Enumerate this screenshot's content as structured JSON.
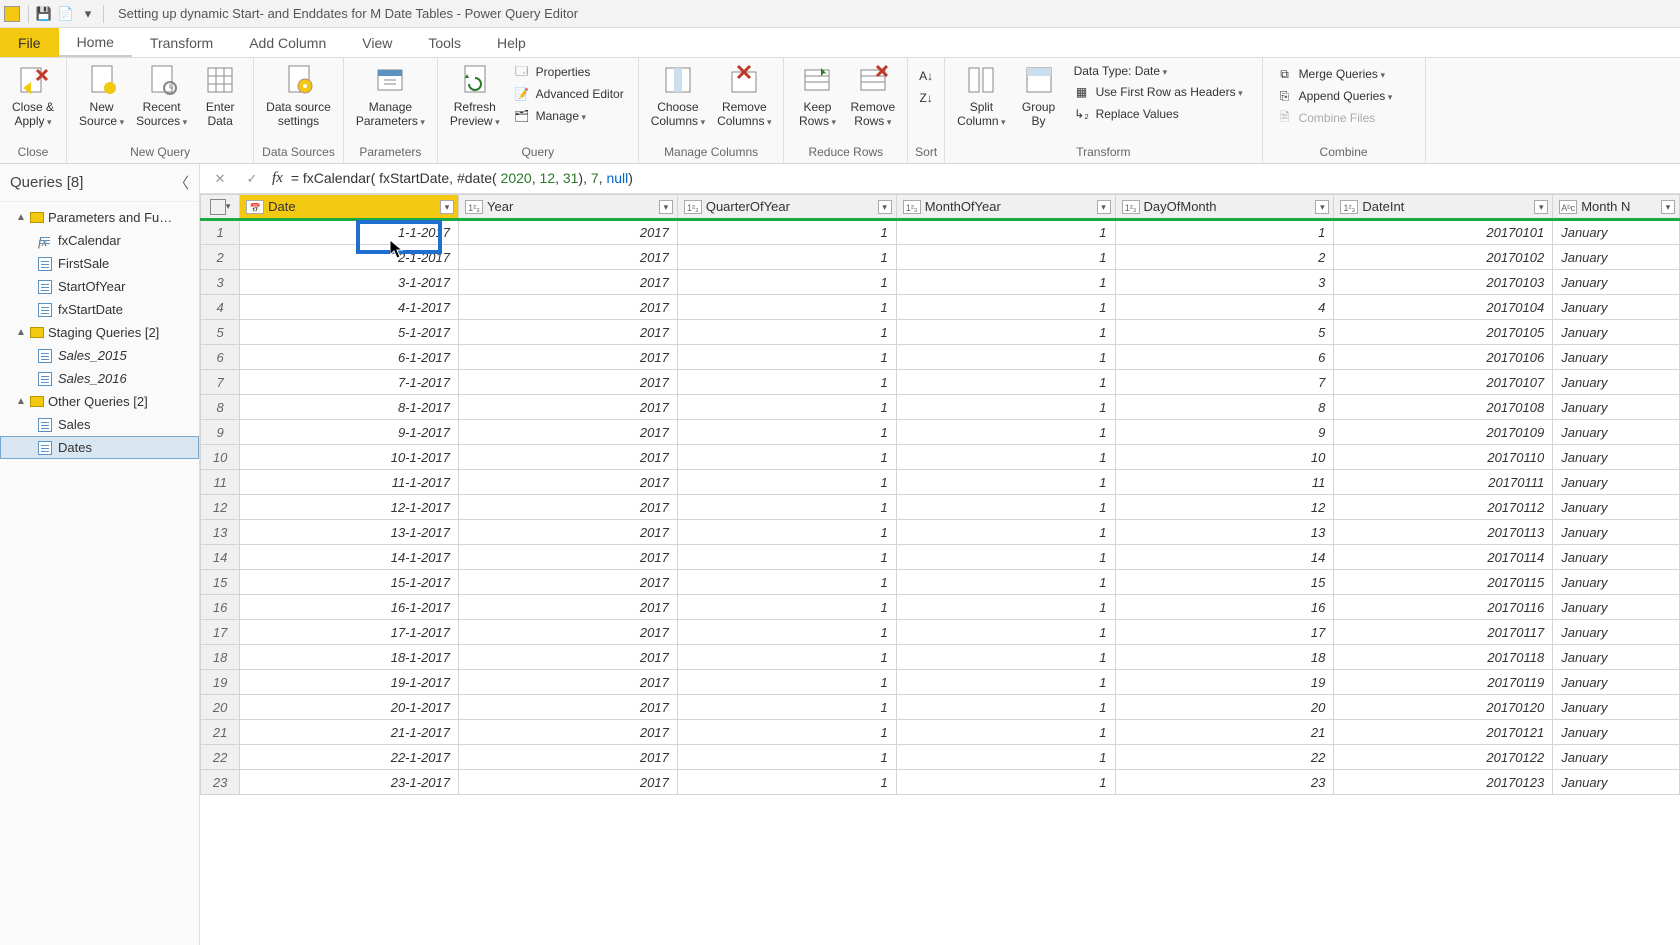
{
  "titlebar": {
    "title": "Setting up dynamic Start- and Enddates for M Date Tables - Power Query Editor"
  },
  "menu": {
    "file": "File",
    "home": "Home",
    "transform": "Transform",
    "addcol": "Add Column",
    "view": "View",
    "tools": "Tools",
    "help": "Help"
  },
  "ribbon": {
    "close": {
      "closeApply": "Close &\nApply",
      "group": "Close"
    },
    "newquery": {
      "newSource": "New\nSource",
      "recentSources": "Recent\nSources",
      "enterData": "Enter\nData",
      "group": "New Query"
    },
    "datasources": {
      "dss": "Data source\nsettings",
      "group": "Data Sources"
    },
    "params": {
      "manageParams": "Manage\nParameters",
      "group": "Parameters"
    },
    "query": {
      "refresh": "Refresh\nPreview",
      "properties": "Properties",
      "advanced": "Advanced Editor",
      "manage": "Manage",
      "group": "Query"
    },
    "manageCols": {
      "choose": "Choose\nColumns",
      "remove": "Remove\nColumns",
      "group": "Manage Columns"
    },
    "reduce": {
      "keep": "Keep\nRows",
      "removeRows": "Remove\nRows",
      "group": "Reduce Rows"
    },
    "sort": {
      "group": "Sort"
    },
    "transform": {
      "split": "Split\nColumn",
      "groupby": "Group\nBy",
      "dtype": "Data Type: Date",
      "firstrowheaders": "Use First Row as Headers",
      "replace": "Replace Values",
      "group": "Transform"
    },
    "combine": {
      "merge": "Merge Queries",
      "append": "Append Queries",
      "combineFiles": "Combine Files",
      "group": "Combine"
    }
  },
  "queriesPane": {
    "header": "Queries [8]",
    "groups": [
      {
        "name": "Parameters and Fu…",
        "items": [
          {
            "label": "fxCalendar",
            "fx": true
          },
          {
            "label": "FirstSale"
          },
          {
            "label": "StartOfYear"
          },
          {
            "label": "fxStartDate"
          }
        ]
      },
      {
        "name": "Staging Queries [2]",
        "items": [
          {
            "label": "Sales_2015",
            "italic": true
          },
          {
            "label": "Sales_2016",
            "italic": true
          }
        ]
      },
      {
        "name": "Other Queries [2]",
        "items": [
          {
            "label": "Sales"
          },
          {
            "label": "Dates",
            "selected": true
          }
        ]
      }
    ]
  },
  "formula": {
    "prefix": "= fxCalendar( fxStartDate, #date( ",
    "n1": "2020",
    "c1": ", ",
    "n2": "12",
    "c2": ", ",
    "n3": "31",
    "mid": "), ",
    "n4": "7",
    "c3": ", ",
    "nullkw": "null",
    "suffix": ")"
  },
  "columns": [
    {
      "key": "Date",
      "label": "Date",
      "type": "📅",
      "selected": true
    },
    {
      "key": "Year",
      "label": "Year",
      "type": "1²₃"
    },
    {
      "key": "QuarterOfYear",
      "label": "QuarterOfYear",
      "type": "1²₃"
    },
    {
      "key": "MonthOfYear",
      "label": "MonthOfYear",
      "type": "1²₃"
    },
    {
      "key": "DayOfMonth",
      "label": "DayOfMonth",
      "type": "1²₃"
    },
    {
      "key": "DateInt",
      "label": "DateInt",
      "type": "1²₃"
    },
    {
      "key": "MonthN",
      "label": "Month N",
      "type": "Aᵇc",
      "textcol": true
    }
  ],
  "rows": [
    {
      "n": 1,
      "Date": "1-1-2017",
      "Year": "2017",
      "QuarterOfYear": "1",
      "MonthOfYear": "1",
      "DayOfMonth": "1",
      "DateInt": "20170101",
      "MonthN": "January"
    },
    {
      "n": 2,
      "Date": "2-1-2017",
      "Year": "2017",
      "QuarterOfYear": "1",
      "MonthOfYear": "1",
      "DayOfMonth": "2",
      "DateInt": "20170102",
      "MonthN": "January"
    },
    {
      "n": 3,
      "Date": "3-1-2017",
      "Year": "2017",
      "QuarterOfYear": "1",
      "MonthOfYear": "1",
      "DayOfMonth": "3",
      "DateInt": "20170103",
      "MonthN": "January"
    },
    {
      "n": 4,
      "Date": "4-1-2017",
      "Year": "2017",
      "QuarterOfYear": "1",
      "MonthOfYear": "1",
      "DayOfMonth": "4",
      "DateInt": "20170104",
      "MonthN": "January"
    },
    {
      "n": 5,
      "Date": "5-1-2017",
      "Year": "2017",
      "QuarterOfYear": "1",
      "MonthOfYear": "1",
      "DayOfMonth": "5",
      "DateInt": "20170105",
      "MonthN": "January"
    },
    {
      "n": 6,
      "Date": "6-1-2017",
      "Year": "2017",
      "QuarterOfYear": "1",
      "MonthOfYear": "1",
      "DayOfMonth": "6",
      "DateInt": "20170106",
      "MonthN": "January"
    },
    {
      "n": 7,
      "Date": "7-1-2017",
      "Year": "2017",
      "QuarterOfYear": "1",
      "MonthOfYear": "1",
      "DayOfMonth": "7",
      "DateInt": "20170107",
      "MonthN": "January"
    },
    {
      "n": 8,
      "Date": "8-1-2017",
      "Year": "2017",
      "QuarterOfYear": "1",
      "MonthOfYear": "1",
      "DayOfMonth": "8",
      "DateInt": "20170108",
      "MonthN": "January"
    },
    {
      "n": 9,
      "Date": "9-1-2017",
      "Year": "2017",
      "QuarterOfYear": "1",
      "MonthOfYear": "1",
      "DayOfMonth": "9",
      "DateInt": "20170109",
      "MonthN": "January"
    },
    {
      "n": 10,
      "Date": "10-1-2017",
      "Year": "2017",
      "QuarterOfYear": "1",
      "MonthOfYear": "1",
      "DayOfMonth": "10",
      "DateInt": "20170110",
      "MonthN": "January"
    },
    {
      "n": 11,
      "Date": "11-1-2017",
      "Year": "2017",
      "QuarterOfYear": "1",
      "MonthOfYear": "1",
      "DayOfMonth": "11",
      "DateInt": "20170111",
      "MonthN": "January"
    },
    {
      "n": 12,
      "Date": "12-1-2017",
      "Year": "2017",
      "QuarterOfYear": "1",
      "MonthOfYear": "1",
      "DayOfMonth": "12",
      "DateInt": "20170112",
      "MonthN": "January"
    },
    {
      "n": 13,
      "Date": "13-1-2017",
      "Year": "2017",
      "QuarterOfYear": "1",
      "MonthOfYear": "1",
      "DayOfMonth": "13",
      "DateInt": "20170113",
      "MonthN": "January"
    },
    {
      "n": 14,
      "Date": "14-1-2017",
      "Year": "2017",
      "QuarterOfYear": "1",
      "MonthOfYear": "1",
      "DayOfMonth": "14",
      "DateInt": "20170114",
      "MonthN": "January"
    },
    {
      "n": 15,
      "Date": "15-1-2017",
      "Year": "2017",
      "QuarterOfYear": "1",
      "MonthOfYear": "1",
      "DayOfMonth": "15",
      "DateInt": "20170115",
      "MonthN": "January"
    },
    {
      "n": 16,
      "Date": "16-1-2017",
      "Year": "2017",
      "QuarterOfYear": "1",
      "MonthOfYear": "1",
      "DayOfMonth": "16",
      "DateInt": "20170116",
      "MonthN": "January"
    },
    {
      "n": 17,
      "Date": "17-1-2017",
      "Year": "2017",
      "QuarterOfYear": "1",
      "MonthOfYear": "1",
      "DayOfMonth": "17",
      "DateInt": "20170117",
      "MonthN": "January"
    },
    {
      "n": 18,
      "Date": "18-1-2017",
      "Year": "2017",
      "QuarterOfYear": "1",
      "MonthOfYear": "1",
      "DayOfMonth": "18",
      "DateInt": "20170118",
      "MonthN": "January"
    },
    {
      "n": 19,
      "Date": "19-1-2017",
      "Year": "2017",
      "QuarterOfYear": "1",
      "MonthOfYear": "1",
      "DayOfMonth": "19",
      "DateInt": "20170119",
      "MonthN": "January"
    },
    {
      "n": 20,
      "Date": "20-1-2017",
      "Year": "2017",
      "QuarterOfYear": "1",
      "MonthOfYear": "1",
      "DayOfMonth": "20",
      "DateInt": "20170120",
      "MonthN": "January"
    },
    {
      "n": 21,
      "Date": "21-1-2017",
      "Year": "2017",
      "QuarterOfYear": "1",
      "MonthOfYear": "1",
      "DayOfMonth": "21",
      "DateInt": "20170121",
      "MonthN": "January"
    },
    {
      "n": 22,
      "Date": "22-1-2017",
      "Year": "2017",
      "QuarterOfYear": "1",
      "MonthOfYear": "1",
      "DayOfMonth": "22",
      "DateInt": "20170122",
      "MonthN": "January"
    },
    {
      "n": 23,
      "Date": "23-1-2017",
      "Year": "2017",
      "QuarterOfYear": "1",
      "MonthOfYear": "1",
      "DayOfMonth": "23",
      "DateInt": "20170123",
      "MonthN": "January"
    }
  ]
}
